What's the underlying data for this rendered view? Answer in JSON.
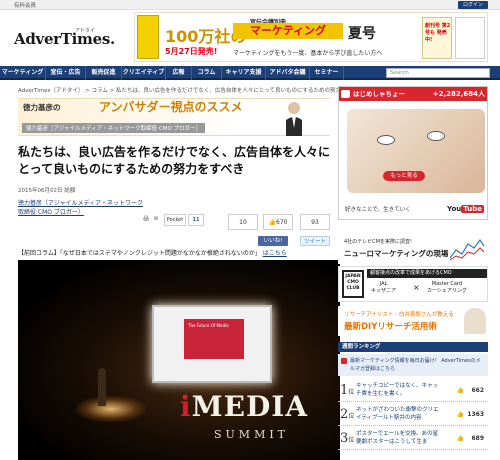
{
  "topbar": {
    "member_label": "有料会員",
    "login_label": "ログイン"
  },
  "logo": {
    "text": "AdverTimes.",
    "subtitle": "アドタイ"
  },
  "banner": {
    "issue_label": "宣伝会議別冊",
    "title_100": "100万社の",
    "title_marketing": "マーケティング",
    "title_summer": "夏号",
    "release_date": "5月27日発売!",
    "catch": "マーケティングをもう一度、基本から学び直したい方へ",
    "badge": "創刊号 第2号も 発売中!"
  },
  "nav": {
    "items": [
      "マーケティング",
      "宣伝・広告",
      "販売促進",
      "クリエイティブ",
      "広報",
      "コラム",
      "キャリア支援",
      "アドバタ会議",
      "セミナー"
    ],
    "search_placeholder": "Search"
  },
  "breadcrumb": "AdverTimes（アドタイ） > コラム > 私たちは、良い広告を作るだけでなく、広告自体を人々にとって良いものにするための努力をすべき",
  "ambassador": {
    "lead": "徳力基彦の",
    "highlight": "アンバサダー視点のススメ",
    "sub": "徳力基彦［アジャイルメディア・ネットワーク取締役 CMO ブロガー］"
  },
  "article": {
    "title": "私たちは、良い広告を作るだけでなく、広告自体を人々にとって良いものにするための努力をすべき",
    "date": "2015年06月02日 総額",
    "author_org": "徳力基彦（アジャイルメディア・ネットワーク",
    "author_role": "取締役 CMO ブロガー）",
    "share": {
      "pocket_label": "Pocket",
      "pocket_count": "11",
      "count_a": "10",
      "count_b": "670",
      "count_c": "93",
      "like_label": "いいね!",
      "tweet_label": "ツイート"
    },
    "lead_text": "【前回コラム】「なぜ日本ではステマやノンクレジット問題がなかなか根絶されないのか」",
    "lead_link": "はこちら"
  },
  "photo": {
    "brand": "MEDIA",
    "brand_i": "i",
    "summit": "SUMMIT",
    "slide_text": "The Future Of Media"
  },
  "sidebar": {
    "jmo_header": "はじめしゃちょー",
    "jmo_count": "+2,282,684",
    "jmo_count_unit": "人",
    "jmo_more": "もっと見る",
    "jmo_copy": "好きなことで、生きていく",
    "jmo_you": "You",
    "jmo_tube": "Tube",
    "neuro_small": "4社のテレビCMを実際に調査!",
    "neuro_big": "ニューロマーケティングの現場",
    "cmo_head": "顧客接点の改革で成果をあげるCMO",
    "cmo_badge": "JAPAN CMO CLUB",
    "cmo_a_company": "JAL",
    "cmo_a_name": "キッザニア",
    "cmo_x": "×",
    "cmo_b_company": "Master Card",
    "cmo_b_name": "カーシェアリング",
    "diy_a": "リサーチアナリスト・白井恵梨さんが教える",
    "diy_b": "最新DIYリサーチ活用術",
    "ranking_title": "週間ランキング",
    "notice": "最新マーケティング情報を毎日お届け！ AdverTimesのメルマガ登録はこちら",
    "ranking": [
      {
        "rank": "1",
        "suffix": "位",
        "text": "キャッチコピーではなく、キャッチ費を生むを書く。",
        "likes": "662"
      },
      {
        "rank": "2",
        "suffix": "位",
        "text": "ネットがざわついた衝撃のクリエイティブ一ルト駅弁の内容",
        "likes": "1363"
      },
      {
        "rank": "3",
        "suffix": "位",
        "text": "ポスターでエールを交換。あの星要劇ポスターはこうして生ま",
        "likes": "689"
      }
    ]
  },
  "colors": {
    "nav": "#1c3f77",
    "accent_red": "#d9252c",
    "ambassador_orange": "#d08000"
  }
}
